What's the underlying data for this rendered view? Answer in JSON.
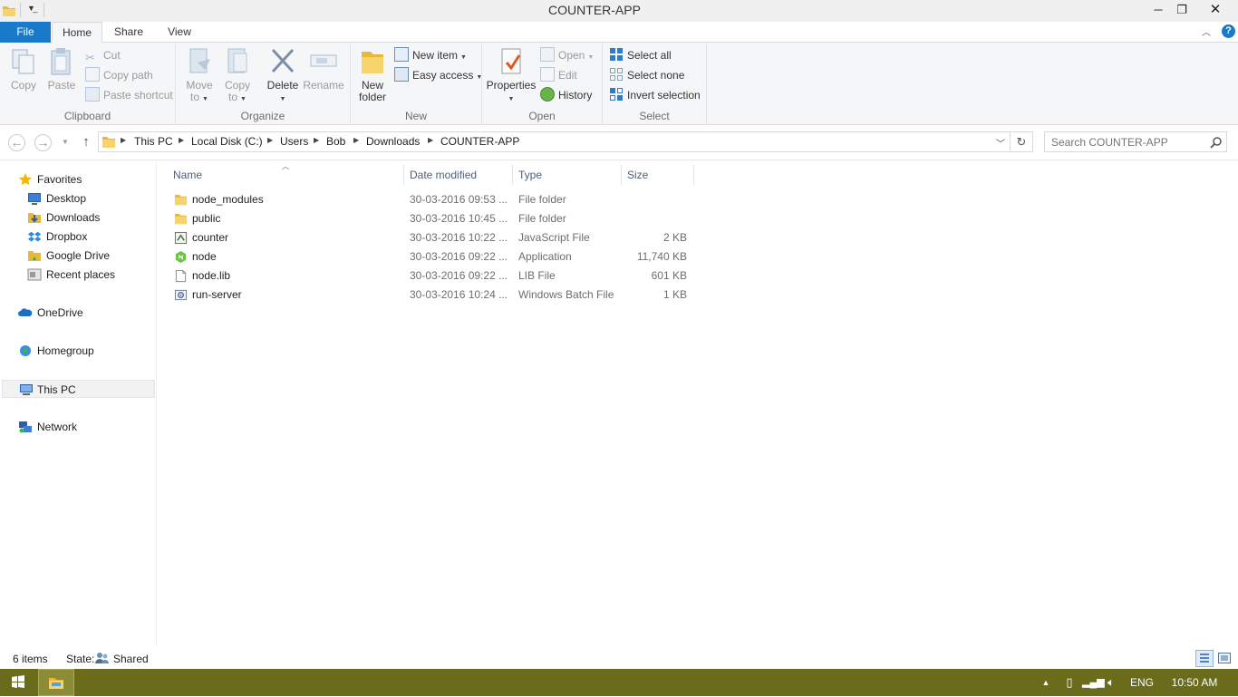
{
  "window": {
    "title": "COUNTER-APP"
  },
  "title_controls": {
    "minimize": "─",
    "restore": "❐",
    "close": "✕"
  },
  "ribbon_tabs": [
    {
      "label": "File"
    },
    {
      "label": "Home"
    },
    {
      "label": "Share"
    },
    {
      "label": "View"
    }
  ],
  "ribbon": {
    "clipboard": {
      "label": "Clipboard",
      "copy": "Copy",
      "paste": "Paste",
      "cut": "Cut",
      "copy_path": "Copy path",
      "paste_shortcut": "Paste shortcut"
    },
    "organize": {
      "label": "Organize",
      "move_to": [
        "Move",
        "to"
      ],
      "copy_to": [
        "Copy",
        "to"
      ],
      "delete": "Delete",
      "rename": "Rename"
    },
    "new": {
      "label": "New",
      "new_folder": [
        "New",
        "folder"
      ],
      "new_item": "New item",
      "easy_access": "Easy access"
    },
    "open": {
      "label": "Open",
      "properties": "Properties",
      "open": "Open",
      "edit": "Edit",
      "history": "History"
    },
    "select": {
      "label": "Select",
      "select_all": "Select all",
      "select_none": "Select none",
      "invert_selection": "Invert selection"
    }
  },
  "address": {
    "crumbs": [
      "This PC",
      "Local Disk (C:)",
      "Users",
      "Bob",
      "Downloads",
      "COUNTER-APP"
    ],
    "search_placeholder": "Search COUNTER-APP"
  },
  "nav_pane": {
    "favorites": "Favorites",
    "favorite_items": [
      "Desktop",
      "Downloads",
      "Dropbox",
      "Google Drive",
      "Recent places"
    ],
    "onedrive": "OneDrive",
    "homegroup": "Homegroup",
    "this_pc": "This PC",
    "network": "Network"
  },
  "file_list": {
    "columns": [
      "Name",
      "Date modified",
      "Type",
      "Size"
    ],
    "rows": [
      {
        "name": "node_modules",
        "date": "30-03-2016 09:53 ...",
        "type": "File folder",
        "size": "",
        "icon": "folder-icon"
      },
      {
        "name": "public",
        "date": "30-03-2016 10:45 ...",
        "type": "File folder",
        "size": "",
        "icon": "folder-icon"
      },
      {
        "name": "counter",
        "date": "30-03-2016 10:22 ...",
        "type": "JavaScript File",
        "size": "2 KB",
        "icon": "js-file-icon"
      },
      {
        "name": "node",
        "date": "30-03-2016 09:22 ...",
        "type": "Application",
        "size": "11,740 KB",
        "icon": "node-app-icon"
      },
      {
        "name": "node.lib",
        "date": "30-03-2016 09:22 ...",
        "type": "LIB File",
        "size": "601 KB",
        "icon": "lib-file-icon"
      },
      {
        "name": "run-server",
        "date": "30-03-2016 10:24 ...",
        "type": "Windows Batch File",
        "size": "1 KB",
        "icon": "batch-file-icon"
      }
    ]
  },
  "status": {
    "items": "6 items",
    "state_label": "State:",
    "state_value": "Shared"
  },
  "taskbar": {
    "language": "ENG",
    "time": "10:50 AM"
  },
  "colors": {
    "file_tab": "#1979ca",
    "taskbar": "#6b6b1c",
    "ribbon_bg": "#f5f6f7"
  }
}
